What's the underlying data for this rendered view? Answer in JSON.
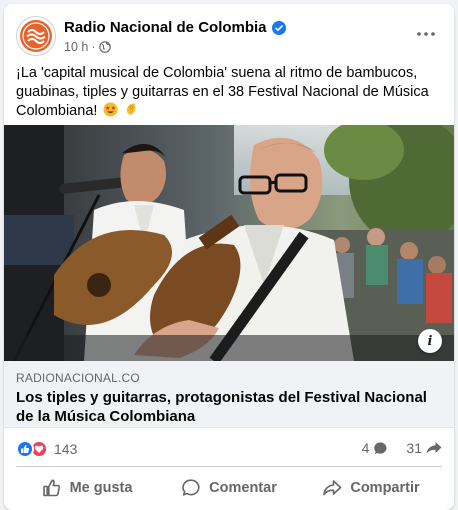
{
  "post": {
    "page_name": "Radio Nacional de Colombia",
    "time": "10 h",
    "separator": "·",
    "text": "¡La 'capital musical de Colombia' suena al ritmo de bambucos, guabinas, tiples y guitarras en el 38 Festival Nacional de Música Colombiana!",
    "emojis": [
      "star-struck-emoji",
      "clapping-hands-emoji"
    ]
  },
  "link": {
    "domain": "RADIONACIONAL.CO",
    "title": "Los tiples y guitarras, protagonistas del Festival Nacional de la Música Colombiana"
  },
  "stats": {
    "reactions_count": "143",
    "comments_count": "4",
    "shares_count": "31"
  },
  "actions": {
    "like": "Me gusta",
    "comment": "Comentar",
    "share": "Compartir"
  },
  "colors": {
    "like_blue": "#1877f2",
    "love_red": "#f33e58",
    "logo_orange": "#e8622c",
    "secondary_text": "#65676b"
  }
}
